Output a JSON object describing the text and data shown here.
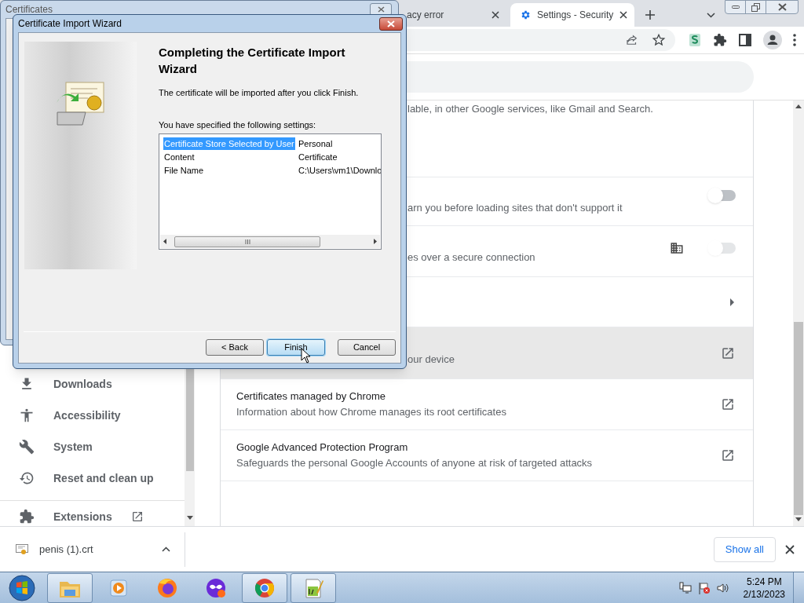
{
  "background_dialog": {
    "title": "Certificates"
  },
  "browser": {
    "tabs": [
      {
        "title": "acy error",
        "selected": false
      },
      {
        "title": "Settings - Security",
        "selected": true
      }
    ],
    "sidebar": {
      "items": [
        {
          "label": "Downloads",
          "external": false
        },
        {
          "label": "Accessibility",
          "external": false
        },
        {
          "label": "System",
          "external": false
        },
        {
          "label": "Reset and clean up",
          "external": false
        },
        {
          "label": "Extensions",
          "external": true
        }
      ]
    },
    "rows": [
      {
        "kind": "text",
        "description": "lable, in other Google services, like Gmail and Search."
      },
      {
        "kind": "toggle",
        "description": "arn you before loading sites that don't support it",
        "on": false,
        "disabled": false,
        "hovered": false
      },
      {
        "kind": "managed_toggle",
        "description": "es over a secure connection",
        "on": false,
        "disabled": true,
        "hovered": false
      },
      {
        "kind": "submenu",
        "hovered": false
      },
      {
        "kind": "link",
        "description": "our device",
        "hovered": true
      },
      {
        "kind": "link",
        "title": "Certificates managed by Chrome",
        "description": "Information about how Chrome manages its root certificates",
        "hovered": false
      },
      {
        "kind": "link",
        "title": "Google Advanced Protection Program",
        "description": "Safeguards the personal Google Accounts of anyone at risk of targeted attacks",
        "hovered": false
      }
    ],
    "download_bar": {
      "file": "penis (1).crt",
      "show_all": "Show all"
    }
  },
  "wizard": {
    "title": "Certificate Import Wizard",
    "heading": "Completing the Certificate Import Wizard",
    "intro": "The certificate will be imported after you click Finish.",
    "settings_label": "You have specified the following settings:",
    "settings": [
      {
        "name": "Certificate Store Selected by User",
        "value": "Personal",
        "selected": true
      },
      {
        "name": "Content",
        "value": "Certificate",
        "selected": false
      },
      {
        "name": "File Name",
        "value": "C:\\Users\\vm1\\Downlo",
        "selected": false
      }
    ],
    "buttons": [
      {
        "label": "< Back",
        "default": false
      },
      {
        "label": "Finish",
        "default": true
      },
      {
        "label": "Cancel",
        "default": false
      }
    ]
  },
  "taskbar": {
    "items": [
      {
        "running": true
      },
      {
        "running": false
      },
      {
        "running": false
      },
      {
        "running": false
      },
      {
        "running": true
      },
      {
        "running": true
      }
    ],
    "time": "5:24 PM",
    "date": "2/13/2023"
  }
}
